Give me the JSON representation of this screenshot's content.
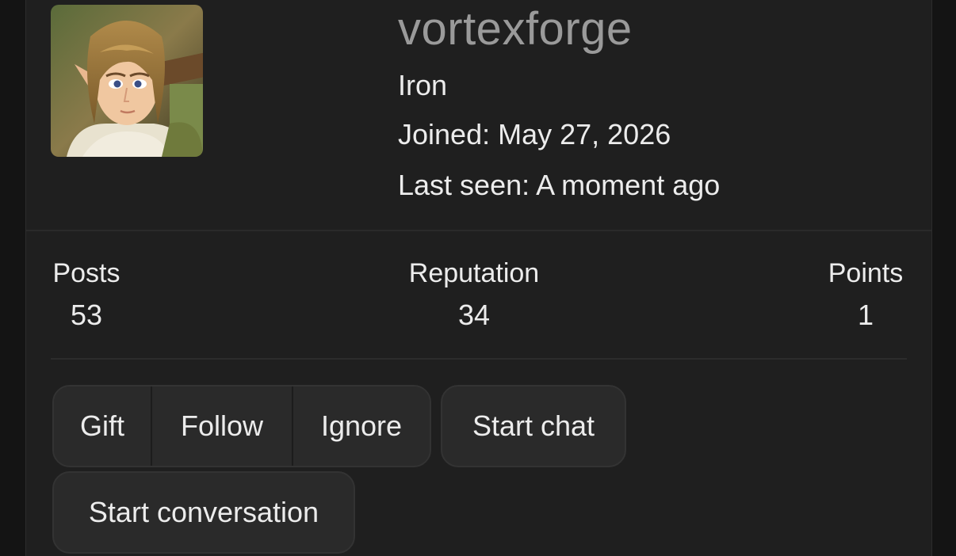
{
  "profile": {
    "username": "vortexforge",
    "rank": "Iron",
    "joined": "Joined: May 27, 2026",
    "last_seen": "Last seen: A moment ago",
    "avatar_icon": "user-avatar-image"
  },
  "stats": {
    "posts_label": "Posts",
    "posts_value": "53",
    "reputation_label": "Reputation",
    "reputation_value": "34",
    "points_label": "Points",
    "points_value": "1"
  },
  "actions": {
    "gift_label": "Gift",
    "follow_label": "Follow",
    "ignore_label": "Ignore",
    "start_chat_label": "Start chat",
    "start_conversation_label": "Start conversation"
  },
  "colors": {
    "background": "#141414",
    "card": "#1f1f1f",
    "button": "#2a2a2a",
    "username": "#9a9a9a",
    "text": "#ececec"
  }
}
